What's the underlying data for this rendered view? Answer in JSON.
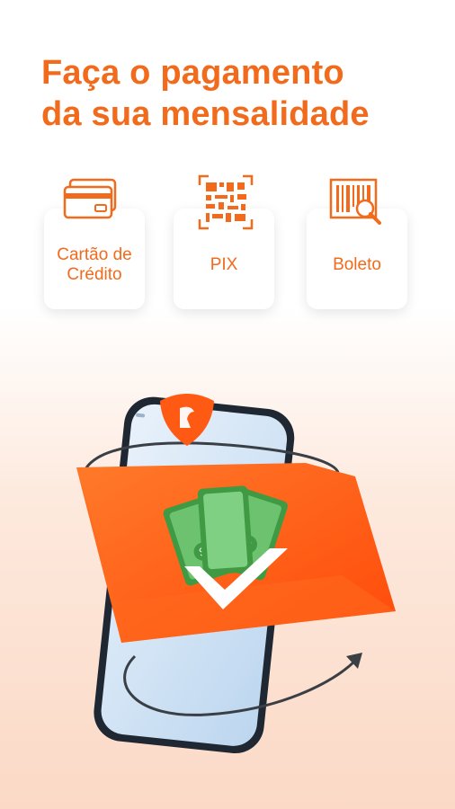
{
  "headline": {
    "line1": "Faça o pagamento",
    "line2": "da sua mensalidade"
  },
  "payment_options": [
    {
      "label_line1": "Cartão de",
      "label_line2": "Crédito",
      "icon": "credit-card-icon"
    },
    {
      "label_line1": "PIX",
      "icon": "qr-code-icon"
    },
    {
      "label_line1": "Boleto",
      "icon": "barcode-search-icon"
    }
  ],
  "colors": {
    "brand_orange": "#f26a1b",
    "card_orange": "#ff5a14",
    "money_green": "#4caf50"
  }
}
